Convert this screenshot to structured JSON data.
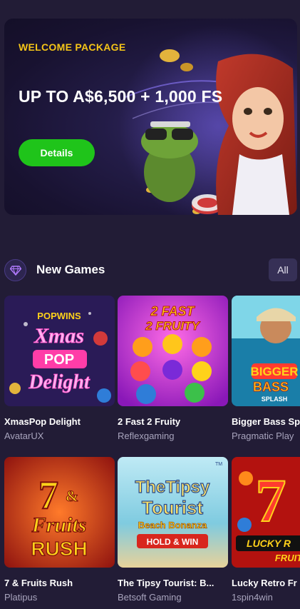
{
  "hero": {
    "eyebrow": "WELCOME PACKAGE",
    "title": "UP TO A$6,500 + 1,000 FS",
    "cta_label": "Details",
    "accent_color": "#f5c518",
    "cta_color": "#1fc41a"
  },
  "section": {
    "icon": "diamond-icon",
    "title": "New Games",
    "all_label": "All"
  },
  "games": [
    {
      "title": "XmasPop Delight",
      "provider": "AvatarUX",
      "art": [
        "POPWINS",
        "Xmas",
        "POP",
        "Delight"
      ]
    },
    {
      "title": "2 Fast 2 Fruity",
      "provider": "Reflexgaming",
      "art": [
        "2 FAST",
        "2 FRUITY"
      ]
    },
    {
      "title": "Bigger Bass Sp",
      "provider": "Pragmatic Play",
      "art": [
        "BIGGER",
        "BASS",
        "SPLASH"
      ]
    },
    {
      "title": "7 & Fruits Rush",
      "provider": "Platipus",
      "art": [
        "7",
        "&",
        "Fruits",
        "RUSH"
      ]
    },
    {
      "title": "The Tipsy Tourist: B...",
      "provider": "Betsoft Gaming",
      "art": [
        "TheTipsy",
        "Tourist",
        "Beach Bonanza",
        "HOLD & WIN",
        "TM"
      ]
    },
    {
      "title": "Lucky Retro Fr",
      "provider": "1spin4win",
      "art": [
        "7",
        "LUCKY R",
        "FRUIT"
      ]
    }
  ]
}
